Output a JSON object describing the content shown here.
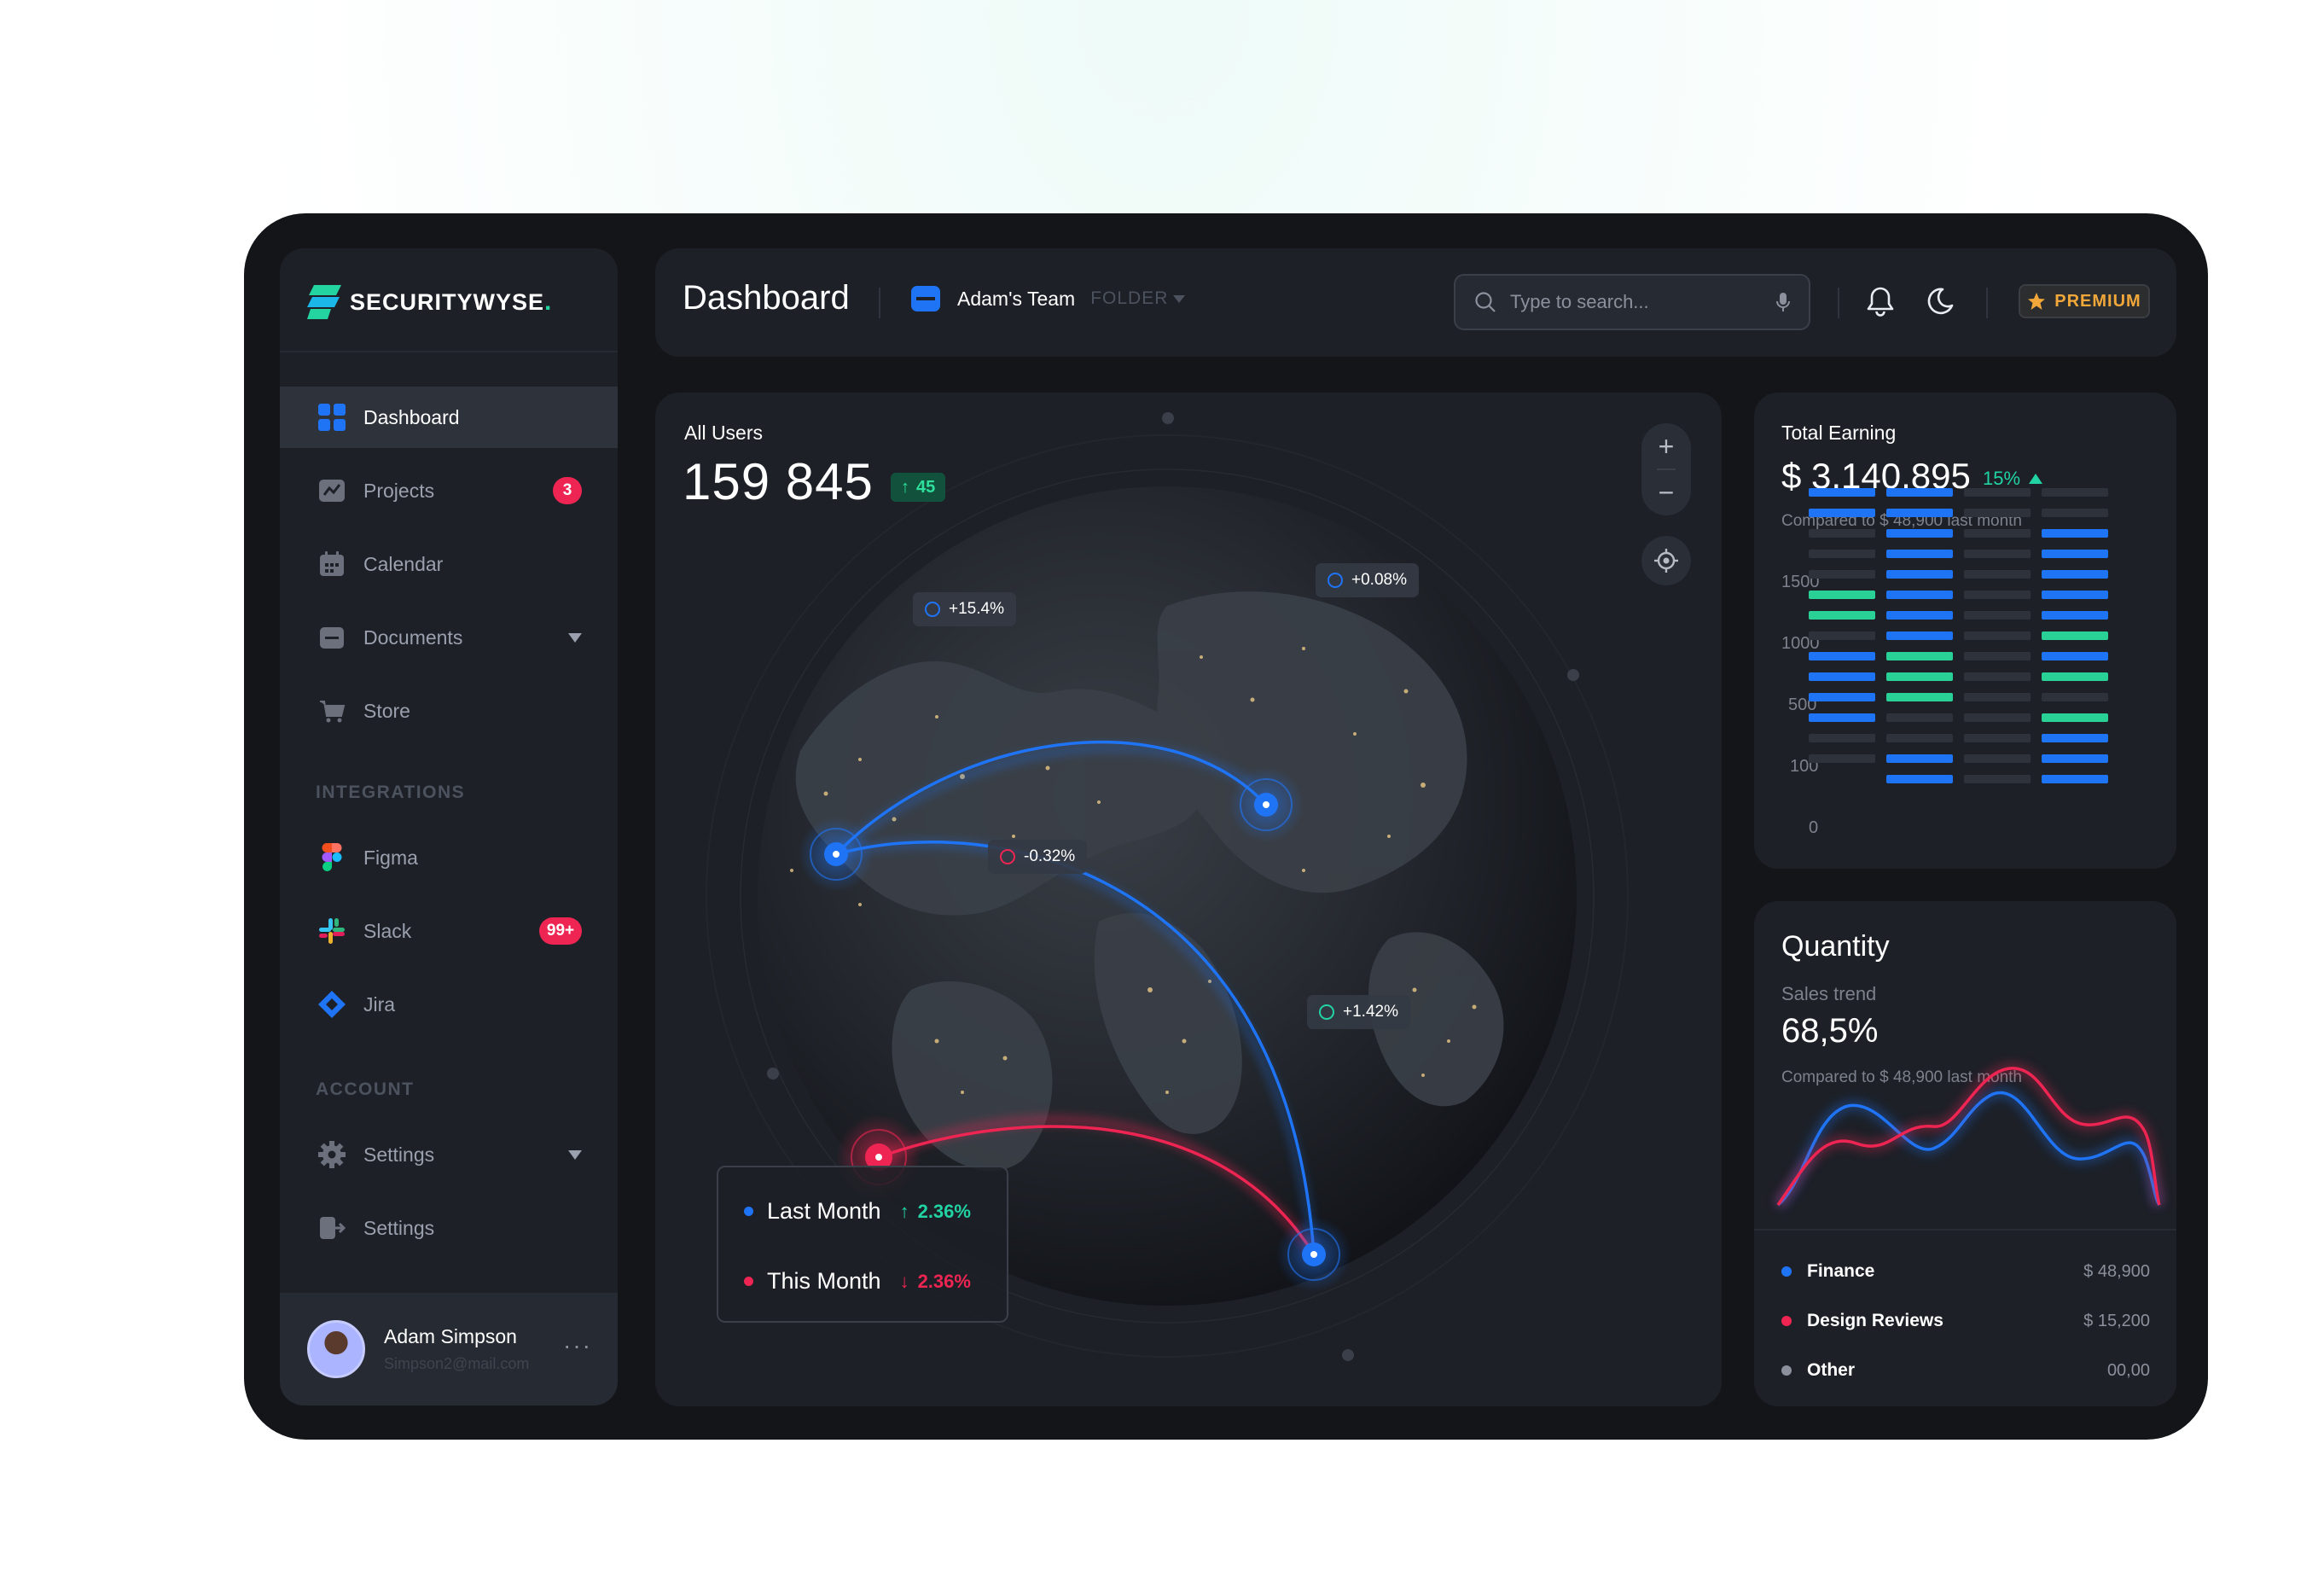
{
  "brand": {
    "name": "SECURITYWYSE",
    "dot": "."
  },
  "sidebar": {
    "items": [
      {
        "label": "Dashboard",
        "icon": "dashboard-icon",
        "active": true
      },
      {
        "label": "Projects",
        "icon": "projects-icon",
        "badge": "3"
      },
      {
        "label": "Calendar",
        "icon": "calendar-icon"
      },
      {
        "label": "Documents",
        "icon": "documents-icon",
        "has_dropdown": true
      },
      {
        "label": "Store",
        "icon": "cart-icon"
      }
    ],
    "integrations_label": "INTEGRATIONS",
    "integrations": [
      {
        "label": "Figma",
        "icon": "figma-icon"
      },
      {
        "label": "Slack",
        "icon": "slack-icon",
        "badge": "99+"
      },
      {
        "label": "Jira",
        "icon": "jira-icon"
      }
    ],
    "account_label": "ACCOUNT",
    "account": [
      {
        "label": "Settings",
        "icon": "gear-icon",
        "has_dropdown": true
      },
      {
        "label": "Settings",
        "icon": "logout-icon"
      }
    ],
    "profile": {
      "name": "Adam Simpson",
      "email": "Simpson2@mail.com"
    }
  },
  "header": {
    "title": "Dashboard",
    "team": "Adam's Team",
    "folder": "FOLDER",
    "search_placeholder": "Type to search...",
    "premium": "PREMIUM"
  },
  "map": {
    "label": "All Users",
    "value": "159 845",
    "delta": "45",
    "tags": [
      {
        "text": "+15.4%",
        "color": "#1f74f6"
      },
      {
        "text": "+0.08%",
        "color": "#1f74f6"
      },
      {
        "text": "-0.32%",
        "color": "#ee2552"
      },
      {
        "text": "+1.42%",
        "color": "#21d3a3"
      }
    ],
    "legend": [
      {
        "label": "Last Month",
        "value": "2.36%",
        "direction": "up",
        "dot": "#1f74f6",
        "color": "#21d3a3"
      },
      {
        "label": "This Month",
        "value": "2.36%",
        "direction": "down",
        "dot": "#ee2552",
        "color": "#ee2552"
      }
    ]
  },
  "earning": {
    "title": "Total Earning",
    "value": "$ 3,140,895",
    "pct": "15%",
    "compare": "Compared to $ 48,900 last month",
    "y_ticks": [
      "1500",
      "1000",
      "500",
      "100",
      "0"
    ]
  },
  "quantity": {
    "title": "Quantity",
    "subtitle": "Sales trend",
    "value": "68,5%",
    "compare": "Compared to $ 48,900 last month",
    "rows": [
      {
        "label": "Finance",
        "amount": "$ 48,900",
        "color": "#1f74f6"
      },
      {
        "label": "Design Reviews",
        "amount": "$ 15,200",
        "color": "#ee2552"
      },
      {
        "label": "Other",
        "amount": "00,00",
        "color": "#8b909c"
      }
    ]
  },
  "colors": {
    "blue": "#1f74f6",
    "red": "#ee2552",
    "green": "#21d3a3",
    "amber": "#f2a73a",
    "bg": "#131519",
    "card": "#1d2027"
  }
}
